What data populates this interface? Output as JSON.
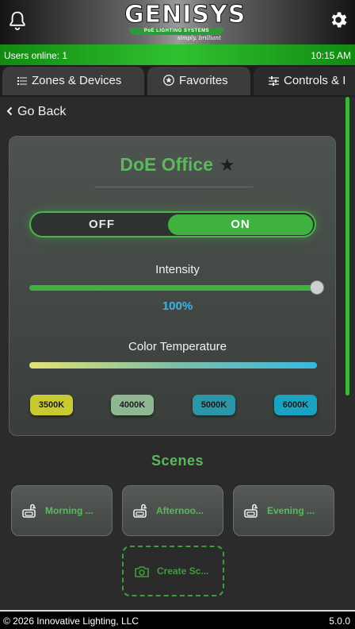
{
  "header": {
    "logo_text": "GENISYS",
    "logo_subtext": "PoE LIGHTING SYSTEMS",
    "logo_tagline": "simply. brilliant",
    "bell_icon": "bell-icon",
    "gear_icon": "gear-icon"
  },
  "status_bar": {
    "users_online": "Users online: 1",
    "time": "10:15 AM"
  },
  "tabs": [
    {
      "label": "Zones & Devices",
      "icon": "list-icon",
      "active": false
    },
    {
      "label": "Favorites",
      "icon": "star-circle-icon",
      "active": false
    },
    {
      "label": "Controls & I",
      "icon": "sliders-icon",
      "active": true
    }
  ],
  "nav": {
    "back_label": "Go Back"
  },
  "room": {
    "title": "DoE Office",
    "favorite_icon": "star-icon",
    "power": {
      "off_label": "OFF",
      "on_label": "ON",
      "state": "ON"
    },
    "intensity": {
      "label": "Intensity",
      "value": 100,
      "value_text": "100%"
    },
    "color_temperature": {
      "label": "Color Temperature",
      "presets": [
        {
          "label": "3500K",
          "color": "#c9c932"
        },
        {
          "label": "4000K",
          "color": "#8fb892"
        },
        {
          "label": "5000K",
          "color": "#2a96a8"
        },
        {
          "label": "6000K",
          "color": "#1aa3c1"
        }
      ]
    }
  },
  "scenes": {
    "title": "Scenes",
    "items": [
      {
        "label": "Morning ...",
        "icon": "scene-lamp-icon"
      },
      {
        "label": "Afternoo...",
        "icon": "scene-lamp-icon"
      },
      {
        "label": "Evening ...",
        "icon": "scene-lamp-icon"
      }
    ],
    "create_label": "Create Sc...",
    "create_icon": "camera-icon"
  },
  "footer": {
    "copyright": "© 2026 Innovative Lighting, LLC",
    "version": "5.0.0"
  },
  "colors": {
    "accent_green": "#3fb23f",
    "title_green": "#5cb85c",
    "percent_blue": "#39b4e6"
  }
}
